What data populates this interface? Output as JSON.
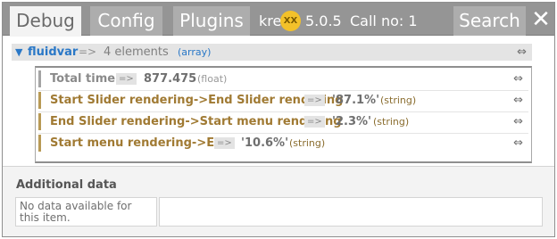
{
  "tabs": {
    "debug": "Debug",
    "config": "Config",
    "plugins": "Plugins",
    "search": "Search"
  },
  "info": {
    "kre": "kre",
    "badge": "XX",
    "version": "5.0.5",
    "call_no": "Call no: 1"
  },
  "close_glyph": "✕",
  "tree": {
    "arrow": "▼",
    "key": "fluidvar",
    "op": "=>",
    "value": "4 elements",
    "type": "(array)",
    "expand_glyph": "⇔",
    "children": [
      {
        "key": "Total time",
        "op": "=>",
        "value": "877.475",
        "type": "(float)"
      },
      {
        "key": "Start Slider rendering->End Slider rendering",
        "op": "=>",
        "value": "'87.1%'",
        "type": "(string)"
      },
      {
        "key": "End Slider rendering->Start menu rendering",
        "op": "=>",
        "value": "'2.3%'",
        "type": "(string)"
      },
      {
        "key": "Start menu rendering->End",
        "op": "=>",
        "value": "'10.6%'",
        "type": "(string)"
      }
    ]
  },
  "additional": {
    "title": "Additional data",
    "no_data": "No data available for this item."
  },
  "colors": {
    "toolbar": "#959595",
    "tab_active_bg": "#f3f3f3",
    "key_blue": "#2a78c7",
    "string_key": "#a07a33",
    "badge": "#f3c12a"
  }
}
